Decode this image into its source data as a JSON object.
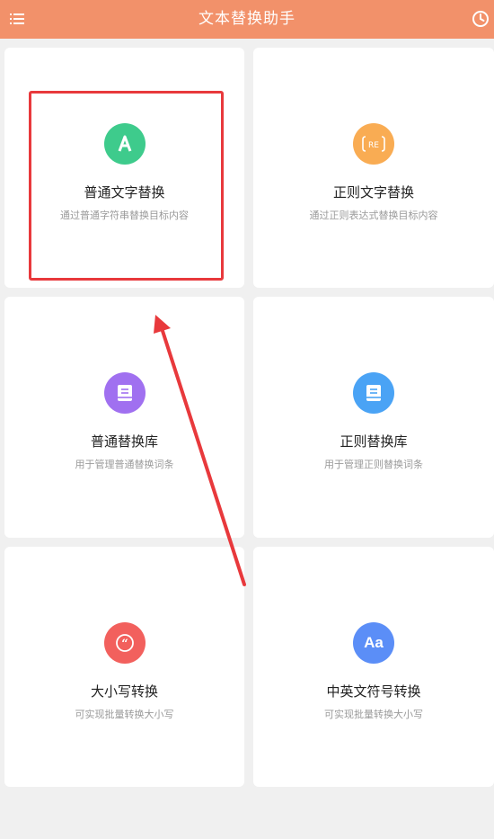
{
  "header": {
    "title": "文本替换助手",
    "background": "#f2916a"
  },
  "cards": [
    {
      "title": "普通文字替换",
      "desc": "通过普通字符串替换目标内容",
      "icon": "letter-a-icon",
      "color": "#3ecb8c",
      "highlighted": true
    },
    {
      "title": "正则文字替换",
      "desc": "通过正则表达式替换目标内容",
      "icon": "regex-icon",
      "color": "#f9ac53"
    },
    {
      "title": "普通替换库",
      "desc": "用于管理普通替换词条",
      "icon": "book-icon",
      "color": "#a070f0"
    },
    {
      "title": "正则替换库",
      "desc": "用于管理正则替换词条",
      "icon": "book-icon",
      "color": "#4aa3f5"
    },
    {
      "title": "大小写转换",
      "desc": "可实现批量转换大小写",
      "icon": "quote-icon",
      "color": "#f2605d"
    },
    {
      "title": "中英文符号转换",
      "desc": "可实现批量转换大小写",
      "icon": "aa-icon",
      "color": "#5b8ef7"
    }
  ],
  "annotation_color": "#e8393c"
}
